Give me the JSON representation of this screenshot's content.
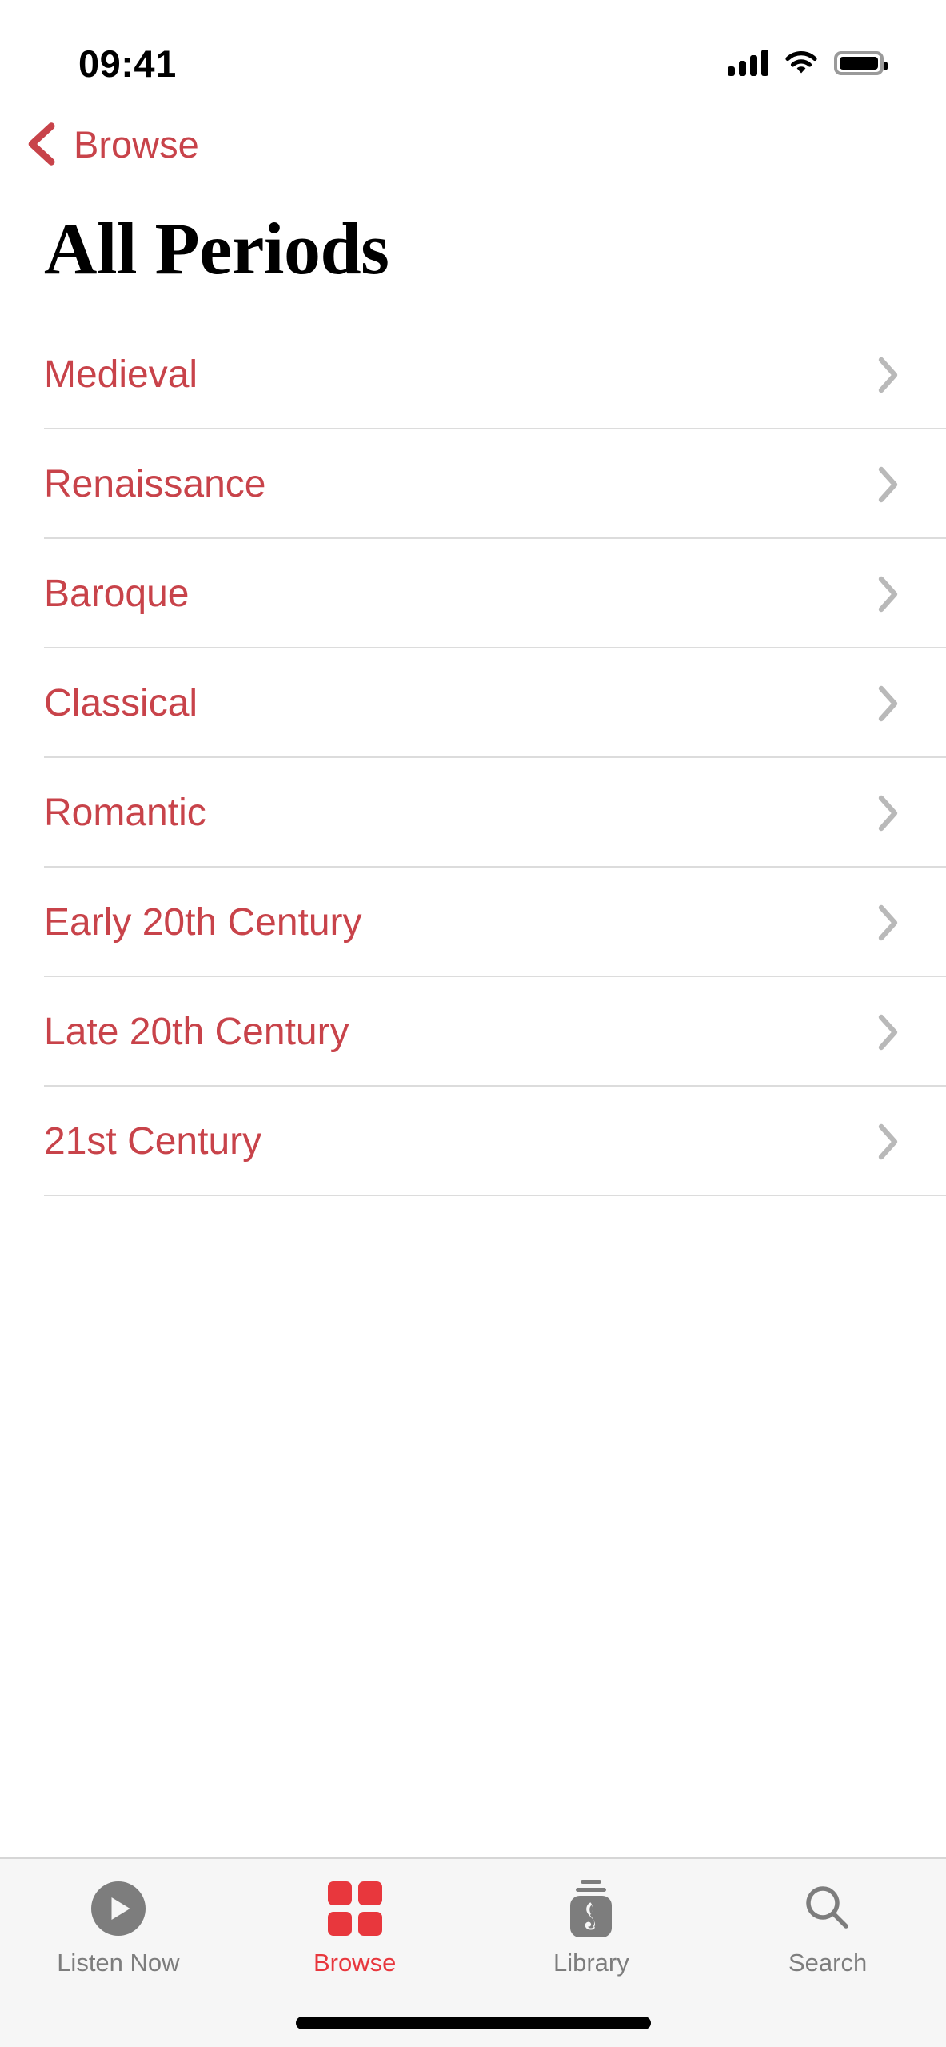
{
  "status_bar": {
    "time": "09:41",
    "cellular_icon": "cellular-signal-icon",
    "wifi_icon": "wifi-icon",
    "battery_icon": "battery-full-icon"
  },
  "nav": {
    "back_icon": "chevron-left-icon",
    "back_label": "Browse"
  },
  "header": {
    "title": "All Periods"
  },
  "list": {
    "disclosure_icon": "chevron-right-icon",
    "rows": [
      {
        "label": "Medieval"
      },
      {
        "label": "Renaissance"
      },
      {
        "label": "Baroque"
      },
      {
        "label": "Classical"
      },
      {
        "label": "Romantic"
      },
      {
        "label": "Early 20th Century"
      },
      {
        "label": "Late 20th Century"
      },
      {
        "label": "21st Century"
      }
    ]
  },
  "tab_bar": {
    "items": [
      {
        "label": "Listen Now",
        "icon": "play-circle-icon",
        "active": false
      },
      {
        "label": "Browse",
        "icon": "grid-squares-icon",
        "active": true
      },
      {
        "label": "Library",
        "icon": "music-library-icon",
        "active": false
      },
      {
        "label": "Search",
        "icon": "magnifier-icon",
        "active": false
      }
    ]
  },
  "colors": {
    "accent_red": "#C8434A",
    "tab_active_red": "#E8373D",
    "inactive_gray": "#7D7D7D",
    "separator": "#DCDCDC",
    "tab_bar_bg": "#F6F6F6"
  }
}
